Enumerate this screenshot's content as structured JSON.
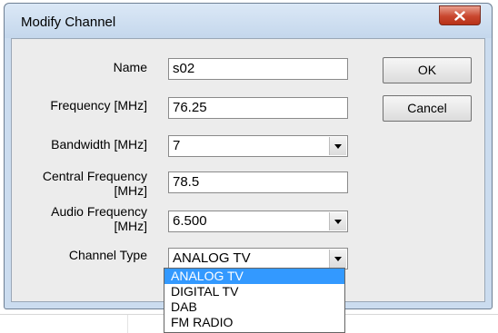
{
  "window": {
    "title": "Modify Channel"
  },
  "form": {
    "name": {
      "label": "Name",
      "value": "s02"
    },
    "frequency": {
      "label": "Frequency [MHz]",
      "value": "76.25"
    },
    "bandwidth": {
      "label": "Bandwidth [MHz]",
      "value": "7"
    },
    "central_frequency": {
      "label_line1": "Central Frequency",
      "label_line2": "[MHz]",
      "value": "78.5"
    },
    "audio_frequency": {
      "label_line1": "Audio Frequency",
      "label_line2": "[MHz]",
      "value": "6.500"
    },
    "channel_type": {
      "label": "Channel Type",
      "value": "ANALOG TV"
    }
  },
  "buttons": {
    "ok": "OK",
    "cancel": "Cancel"
  },
  "channel_type_options": [
    "ANALOG TV",
    "DIGITAL TV",
    "DAB",
    "FM RADIO"
  ],
  "icons": {
    "close": "close-icon",
    "dropdown": "chevron-down-icon"
  },
  "colors": {
    "selection": "#3399ff",
    "close_button": "#c9472f",
    "title_bar": "#c4d7ec"
  }
}
